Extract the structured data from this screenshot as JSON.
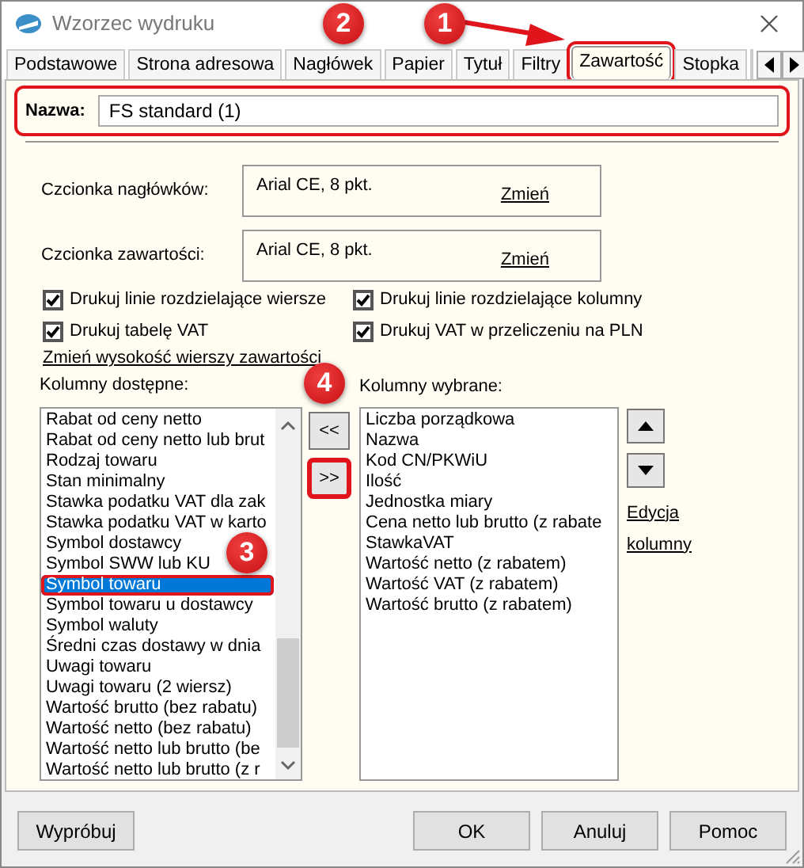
{
  "window": {
    "title": "Wzorzec wydruku"
  },
  "tabs": [
    {
      "label": "Podstawowe",
      "selected": false,
      "highlighted": false
    },
    {
      "label": "Strona adresowa",
      "selected": false,
      "highlighted": false
    },
    {
      "label": "Nagłówek",
      "selected": false,
      "highlighted": false
    },
    {
      "label": "Papier",
      "selected": false,
      "highlighted": false
    },
    {
      "label": "Tytuł",
      "selected": false,
      "highlighted": false
    },
    {
      "label": "Filtry",
      "selected": false,
      "highlighted": false
    },
    {
      "label": "Zawartość",
      "selected": true,
      "highlighted": true
    },
    {
      "label": "Stopka",
      "selected": false,
      "highlighted": false
    }
  ],
  "name_field": {
    "label": "Nazwa:",
    "value": "FS standard (1)",
    "highlighted": true
  },
  "fonts": [
    {
      "label": "Czcionka nagłówków:",
      "value": "Arial CE, 8 pkt.",
      "link": "Zmień"
    },
    {
      "label": "Czcionka zawartości:",
      "value": "Arial CE, 8 pkt.",
      "link": "Zmień"
    }
  ],
  "checkboxes": [
    {
      "label": "Drukuj linie rozdzielające wiersze",
      "checked": true
    },
    {
      "label": "Drukuj linie rozdzielające kolumny",
      "checked": true
    },
    {
      "label": "Drukuj tabelę VAT",
      "checked": true
    },
    {
      "label": "Drukuj VAT w przeliczeniu na PLN",
      "checked": true
    }
  ],
  "row_height_link": "Zmień wysokość wierszy zawartości",
  "available": {
    "label": "Kolumny dostępne:",
    "items": [
      {
        "text": "Rabat od ceny netto",
        "selected": false,
        "highlighted": false
      },
      {
        "text": "Rabat od ceny netto lub brut",
        "selected": false,
        "highlighted": false
      },
      {
        "text": "Rodzaj towaru",
        "selected": false,
        "highlighted": false
      },
      {
        "text": "Stan minimalny",
        "selected": false,
        "highlighted": false
      },
      {
        "text": "Stawka podatku VAT dla zak",
        "selected": false,
        "highlighted": false
      },
      {
        "text": "Stawka podatku VAT w karto",
        "selected": false,
        "highlighted": false
      },
      {
        "text": "Symbol dostawcy",
        "selected": false,
        "highlighted": false
      },
      {
        "text": "Symbol SWW lub KU",
        "selected": false,
        "highlighted": false
      },
      {
        "text": "Symbol towaru",
        "selected": true,
        "highlighted": true
      },
      {
        "text": "Symbol towaru u dostawcy",
        "selected": false,
        "highlighted": false
      },
      {
        "text": "Symbol waluty",
        "selected": false,
        "highlighted": false
      },
      {
        "text": "Średni czas dostawy w dnia",
        "selected": false,
        "highlighted": false
      },
      {
        "text": "Uwagi towaru",
        "selected": false,
        "highlighted": false
      },
      {
        "text": "Uwagi towaru (2 wiersz)",
        "selected": false,
        "highlighted": false
      },
      {
        "text": "Wartość brutto (bez rabatu)",
        "selected": false,
        "highlighted": false
      },
      {
        "text": "Wartość netto (bez rabatu)",
        "selected": false,
        "highlighted": false
      },
      {
        "text": "Wartość netto lub brutto (be",
        "selected": false,
        "highlighted": false
      },
      {
        "text": "Wartość netto lub brutto (z r",
        "selected": false,
        "highlighted": false
      }
    ]
  },
  "move_buttons": [
    {
      "label": "<<",
      "highlighted": false
    },
    {
      "label": ">>",
      "highlighted": true
    }
  ],
  "selected_columns": {
    "label": "Kolumny wybrane:",
    "items": [
      "Liczba porządkowa",
      "Nazwa",
      "Kod CN/PKWiU",
      "Ilość",
      "Jednostka miary",
      "Cena netto lub brutto (z rabate",
      "StawkaVAT",
      "Wartość netto (z rabatem)",
      "Wartość VAT (z rabatem)",
      "Wartość brutto (z rabatem)"
    ]
  },
  "edit_link": "Edycja kolumny",
  "buttons": [
    {
      "label": "Wypróbuj"
    },
    {
      "label": "OK"
    },
    {
      "label": "Anuluj"
    },
    {
      "label": "Pomoc"
    }
  ],
  "annotations": [
    {
      "number": "1"
    },
    {
      "number": "2"
    },
    {
      "number": "3"
    },
    {
      "number": "4"
    }
  ]
}
